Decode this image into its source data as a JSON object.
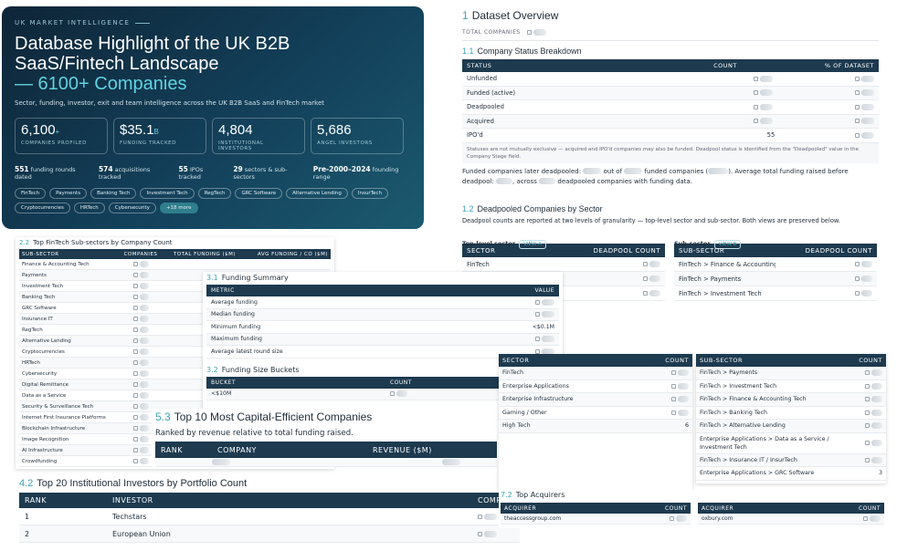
{
  "hero": {
    "eyebrow": "UK MARKET INTELLIGENCE",
    "title_line1": "Database Highlight of the UK B2B",
    "title_line2": "SaaS/Fintech Landscape",
    "title_accent": "— 6100+ Companies",
    "subtitle": "Sector, funding, investor, exit and team intelligence across the UK B2B SaaS and FinTech market",
    "stats": [
      {
        "value": "6,100",
        "suffix": "+",
        "label": "COMPANIES PROFILED"
      },
      {
        "value": "$35.1",
        "suffix": "B",
        "label": "FUNDING TRACKED"
      },
      {
        "value": "4,804",
        "suffix": "",
        "label": "INSTITUTIONAL INVESTORS"
      },
      {
        "value": "5,686",
        "suffix": "",
        "label": "ANGEL INVESTORS"
      }
    ],
    "facts": [
      {
        "n": "551",
        "t": "funding rounds dated"
      },
      {
        "n": "574",
        "t": "acquisitions tracked"
      },
      {
        "n": "55",
        "t": "IPOs tracked"
      },
      {
        "n": "29",
        "t": "sectors & sub-sectors"
      },
      {
        "n": "Pre-2000–2024",
        "t": "founding range"
      }
    ],
    "tags": [
      "FinTech",
      "Payments",
      "Banking Tech",
      "Investment Tech",
      "RegTech",
      "GRC Software",
      "Alternative Lending",
      "InsurTech",
      "Cryptocurrencies",
      "HRTech",
      "Cybersecurity"
    ],
    "more_tag": "+18 more"
  },
  "dataset": {
    "num": "1",
    "title": "Dataset Overview",
    "total_label": "TOTAL COMPANIES",
    "status_num": "1.1",
    "status_title": "Company Status Breakdown",
    "status_headers": [
      "STATUS",
      "COUNT",
      "% OF DATASET"
    ],
    "status_rows": [
      {
        "status": "Unfunded",
        "count": ""
      },
      {
        "status": "Funded (active)",
        "count": ""
      },
      {
        "status": "Deadpooled",
        "count": ""
      },
      {
        "status": "Acquired",
        "count": ""
      },
      {
        "status": "IPO'd",
        "count": "55"
      }
    ],
    "note": "Statuses are not mutually exclusive — acquired and IPO'd companies may also be funded. Deadpool status is identified from the \"Deadpooled\" value in the Company Stage field.",
    "para_a": "Funded companies later deadpooled:",
    "para_b": "out of",
    "para_c": "funded companies (",
    "para_d": "). Average total funding raised before",
    "para_e": "deadpool:",
    "para_f": ", across",
    "para_g": "deadpooled companies with funding data."
  },
  "deadpool": {
    "num": "1.2",
    "title": "Deadpooled Companies by Sector",
    "intro": "Deadpool counts are reported at two levels of granularity — top-level sector and sub-sector. Both views are preserved below.",
    "left_label": "Top-level sector",
    "left_pill": "VIEW A",
    "right_label": "Sub-sector",
    "right_pill": "VIEW B",
    "left_headers": [
      "SECTOR",
      "DEADPOOL COUNT"
    ],
    "right_headers": [
      "SUB-SECTOR",
      "DEADPOOL COUNT"
    ],
    "left_rows": [
      "FinTech",
      "",
      ""
    ],
    "right_rows": [
      "FinTech > Finance & Accounting Tech",
      "FinTech > Payments",
      "FinTech > Investment Tech"
    ]
  },
  "fintech": {
    "num": "2.2",
    "title": "Top FinTech Sub-sectors by Company Count",
    "headers": [
      "SUB-SECTOR",
      "COMPANIES",
      "TOTAL FUNDING ($M)",
      "AVG FUNDING / CO ($M)"
    ],
    "rows": [
      "Finance & Accounting Tech",
      "Payments",
      "Investment Tech",
      "Banking Tech",
      "GRC Software",
      "Insurance IT",
      "RegTech",
      "Alternative Lending",
      "Cryptocurrencies",
      "HRTech",
      "Cybersecurity",
      "Digital Remittance",
      "Data as a Service",
      "Security & Surveillance Tech",
      "Internet First Insurance Platforms",
      "Blockchain Infrastructure",
      "Image Recognition",
      "AI Infrastructure",
      "Crowdfunding"
    ]
  },
  "funding": {
    "num": "3.1",
    "title": "Funding Summary",
    "headers": [
      "METRIC",
      "VALUE"
    ],
    "rows": [
      {
        "m": "Average funding",
        "v": ""
      },
      {
        "m": "Median funding",
        "v": ""
      },
      {
        "m": "Minimum funding",
        "v": "<$0.1M"
      },
      {
        "m": "Maximum funding",
        "v": ""
      },
      {
        "m": "Average latest round size",
        "v": ""
      }
    ],
    "buckets_num": "3.2",
    "buckets_title": "Funding Size Buckets",
    "bucket_headers": [
      "BUCKET",
      "COUNT"
    ],
    "bucket_rows": [
      "<$10M"
    ]
  },
  "top10": {
    "num": "5.3",
    "title": "Top 10 Most Capital-Efficient Companies",
    "subtitle": "Ranked by revenue relative to total funding raised.",
    "headers": [
      "RANK",
      "COMPANY",
      "REVENUE ($M)"
    ]
  },
  "investors": {
    "num": "4.2",
    "title": "Top 20 Institutional Investors by Portfolio Count",
    "headers": [
      "RANK",
      "INVESTOR",
      "COMPA"
    ],
    "rows": [
      {
        "rank": "1",
        "name": "Techstars"
      },
      {
        "rank": "2",
        "name": "European Union"
      }
    ]
  },
  "sectors": {
    "headers": [
      "SECTOR",
      "COUNT"
    ],
    "rows": [
      {
        "s": "FinTech",
        "c": ""
      },
      {
        "s": "Enterprise Applications",
        "c": ""
      },
      {
        "s": "Enterprise Infrastructure",
        "c": ""
      },
      {
        "s": "Gaming / Other",
        "c": ""
      },
      {
        "s": "High Tech",
        "c": "6"
      }
    ]
  },
  "subsectors": {
    "headers": [
      "SUB-SECTOR",
      "COUNT"
    ],
    "rows": [
      {
        "s": "FinTech > Payments",
        "c": ""
      },
      {
        "s": "FinTech > Investment Tech",
        "c": ""
      },
      {
        "s": "FinTech > Finance & Accounting Tech",
        "c": ""
      },
      {
        "s": "FinTech > Banking Tech",
        "c": ""
      },
      {
        "s": "FinTech > Alternative Lending",
        "c": ""
      },
      {
        "s": "Enterprise Applications > Data as a Service / Investment Tech",
        "c": ""
      },
      {
        "s": "FinTech > Insurance IT / InsurTech",
        "c": ""
      },
      {
        "s": "Enterprise Applications > GRC Software",
        "c": "3"
      }
    ]
  },
  "acquirers": {
    "num": "7.2",
    "title": "Top Acquirers",
    "headers": [
      "ACQUIRER",
      "COUNT"
    ],
    "left_first": "theaccessgroup.com",
    "right_first": "oxbury.com"
  }
}
